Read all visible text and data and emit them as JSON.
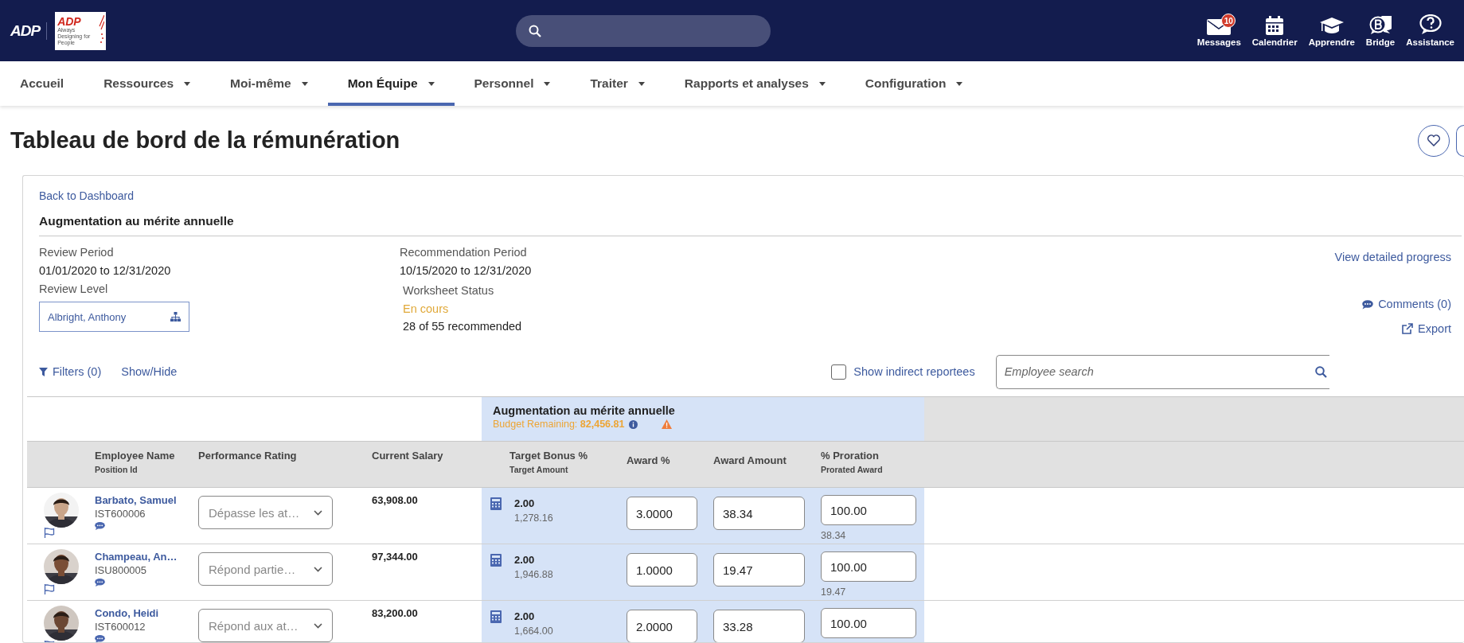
{
  "header": {
    "logo": "ADP",
    "brand_logo": {
      "mark": "ADP",
      "tagline": "Always Designing for People"
    },
    "tools": [
      {
        "kind": "mail",
        "label": "Messages",
        "badge": "10"
      },
      {
        "kind": "calendar",
        "label": "Calendrier"
      },
      {
        "kind": "learn",
        "label": "Apprendre"
      },
      {
        "kind": "bridge",
        "label": "Bridge"
      },
      {
        "kind": "help",
        "label": "Assistance"
      }
    ]
  },
  "nav": [
    {
      "label": "Accueil",
      "dropdown": false,
      "selected": false
    },
    {
      "label": "Ressources",
      "dropdown": true,
      "selected": false
    },
    {
      "label": "Moi-même",
      "dropdown": true,
      "selected": false
    },
    {
      "label": "Mon Équipe",
      "dropdown": true,
      "selected": true
    },
    {
      "label": "Personnel",
      "dropdown": true,
      "selected": false
    },
    {
      "label": "Traiter",
      "dropdown": true,
      "selected": false
    },
    {
      "label": "Rapports et analyses",
      "dropdown": true,
      "selected": false
    },
    {
      "label": "Configuration",
      "dropdown": true,
      "selected": false
    }
  ],
  "page_title": "Tableau de bord de la rémunération",
  "card": {
    "back_link": "Back to Dashboard",
    "title": "Augmentation au mérite annuelle",
    "review_period": {
      "label": "Review Period",
      "value": "01/01/2020 to 12/31/2020"
    },
    "review_level": {
      "label": "Review Level",
      "value": "Albright, Anthony"
    },
    "recommendation_period": {
      "label": "Recommendation Period",
      "value": "10/15/2020 to 12/31/2020"
    },
    "worksheet_status": {
      "label": "Worksheet Status",
      "status": "En cours",
      "progress": "28 of 55 recommended"
    },
    "actions": {
      "progress": "View detailed progress",
      "comments": "Comments (0)",
      "export": "Export"
    },
    "filters": "Filters (0)",
    "show_hide": "Show/Hide",
    "indirect": {
      "label": "Show indirect reportees",
      "checked": false
    },
    "search": {
      "placeholder": "Employee search"
    }
  },
  "table": {
    "group": {
      "title": "Augmentation au mérite annuelle",
      "budget": "Budget Remaining: **82,456.81**"
    },
    "columns": [
      {
        "label": "Employee Name",
        "sublabel": "Position Id"
      },
      {
        "label": "Performance Rating"
      },
      {
        "label": "Current Salary"
      },
      {
        "label": "Target Bonus %",
        "sublabel": "Target Amount"
      },
      {
        "label": "Award %"
      },
      {
        "label": "Award Amount"
      },
      {
        "label": "% Proration",
        "sublabel": "Prorated Award"
      }
    ],
    "rows": [
      {
        "name": "Barbato, Samuel",
        "position_id": "IST600006",
        "rating": "Dépasse les at…",
        "salary": "63,908.00",
        "target_bonus": "2.00",
        "target_amount": "1,278.16",
        "award_pct": "3.0000",
        "award_amount": "38.34",
        "proration": "100.00",
        "prorated_award": "38.34"
      },
      {
        "name": "Champeau, An…",
        "position_id": "ISU800005",
        "rating": "Répond partie…",
        "salary": "97,344.00",
        "target_bonus": "2.00",
        "target_amount": "1,946.88",
        "award_pct": "1.0000",
        "award_amount": "19.47",
        "proration": "100.00",
        "prorated_award": "19.47"
      },
      {
        "name": "Condo, Heidi",
        "position_id": "IST600012",
        "rating": "Répond aux at…",
        "salary": "83,200.00",
        "target_bonus": "2.00",
        "target_amount": "1,664.00",
        "award_pct": "2.0000",
        "award_amount": "33.28",
        "proration": "100.00"
      }
    ]
  }
}
